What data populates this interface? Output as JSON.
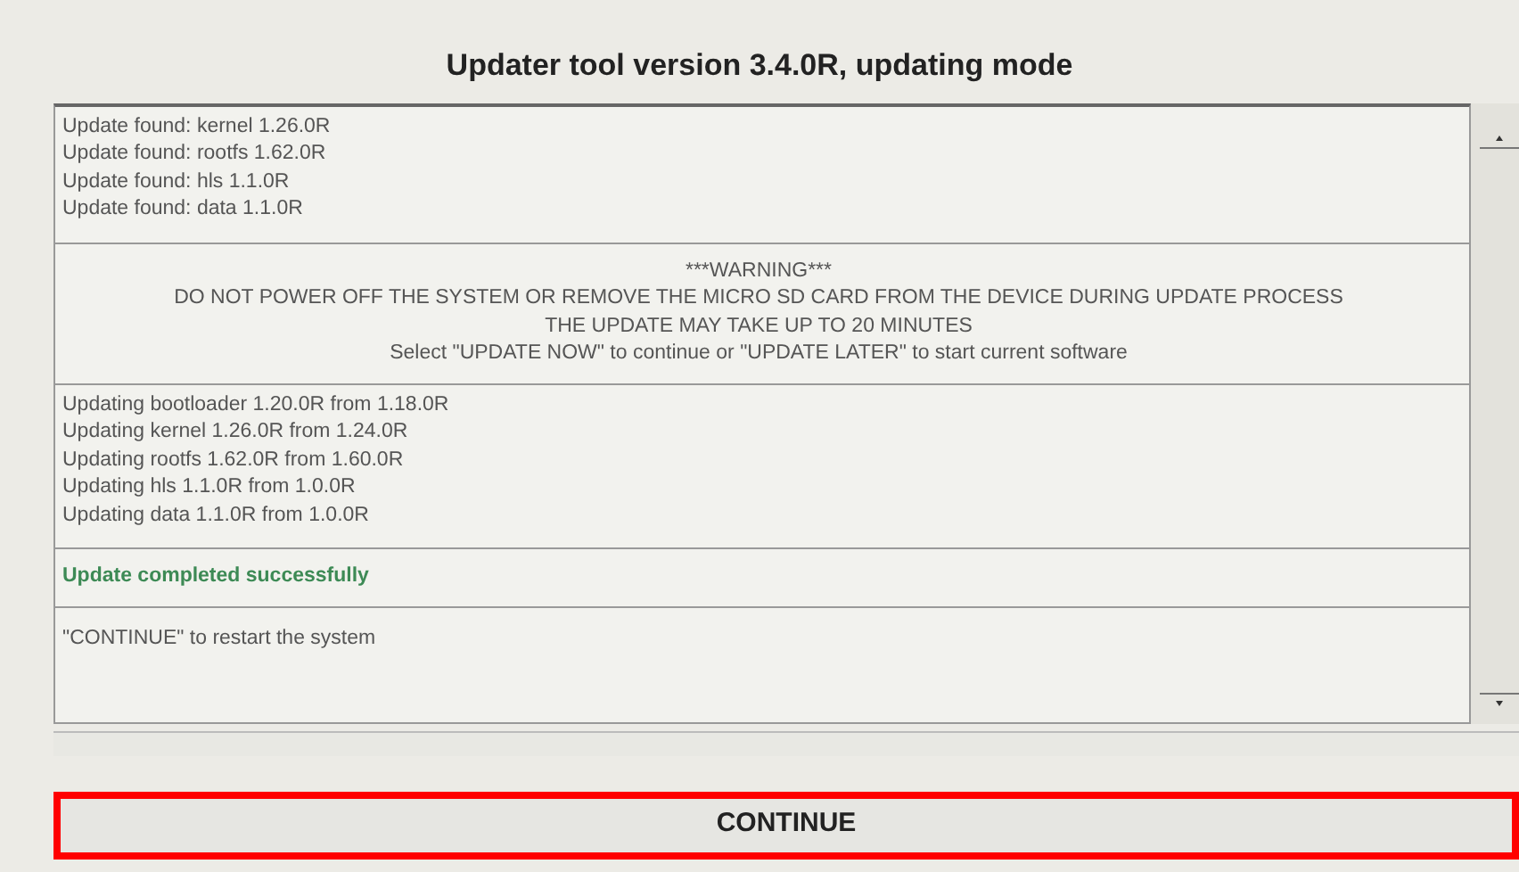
{
  "window": {
    "title": "Updater tool version 3.4.0R, updating mode"
  },
  "log": {
    "sections": [
      {
        "kind": "lines",
        "lines": [
          "Update found: kernel 1.26.0R",
          "Update found: rootfs 1.62.0R",
          "Update found: hls 1.1.0R",
          "Update found: data 1.1.0R"
        ]
      },
      {
        "kind": "warning",
        "lines": [
          "***WARNING***",
          "DO NOT POWER OFF THE SYSTEM OR REMOVE THE MICRO SD CARD FROM THE DEVICE DURING UPDATE PROCESS",
          "THE UPDATE MAY TAKE UP TO 20 MINUTES",
          "Select \"UPDATE NOW\" to continue or \"UPDATE LATER\" to start current software"
        ]
      },
      {
        "kind": "lines",
        "lines": [
          "Updating bootloader 1.20.0R from 1.18.0R",
          "Updating kernel 1.26.0R from 1.24.0R",
          "Updating rootfs 1.62.0R from 1.60.0R",
          "Updating hls 1.1.0R from 1.0.0R",
          "Updating data 1.1.0R from 1.0.0R"
        ]
      },
      {
        "kind": "success",
        "lines": [
          "Update completed successfully"
        ]
      },
      {
        "kind": "lines",
        "lines": [
          "\"CONTINUE\" to restart the system"
        ]
      }
    ]
  },
  "button": {
    "label": "CONTINUE",
    "highlighted": true
  }
}
